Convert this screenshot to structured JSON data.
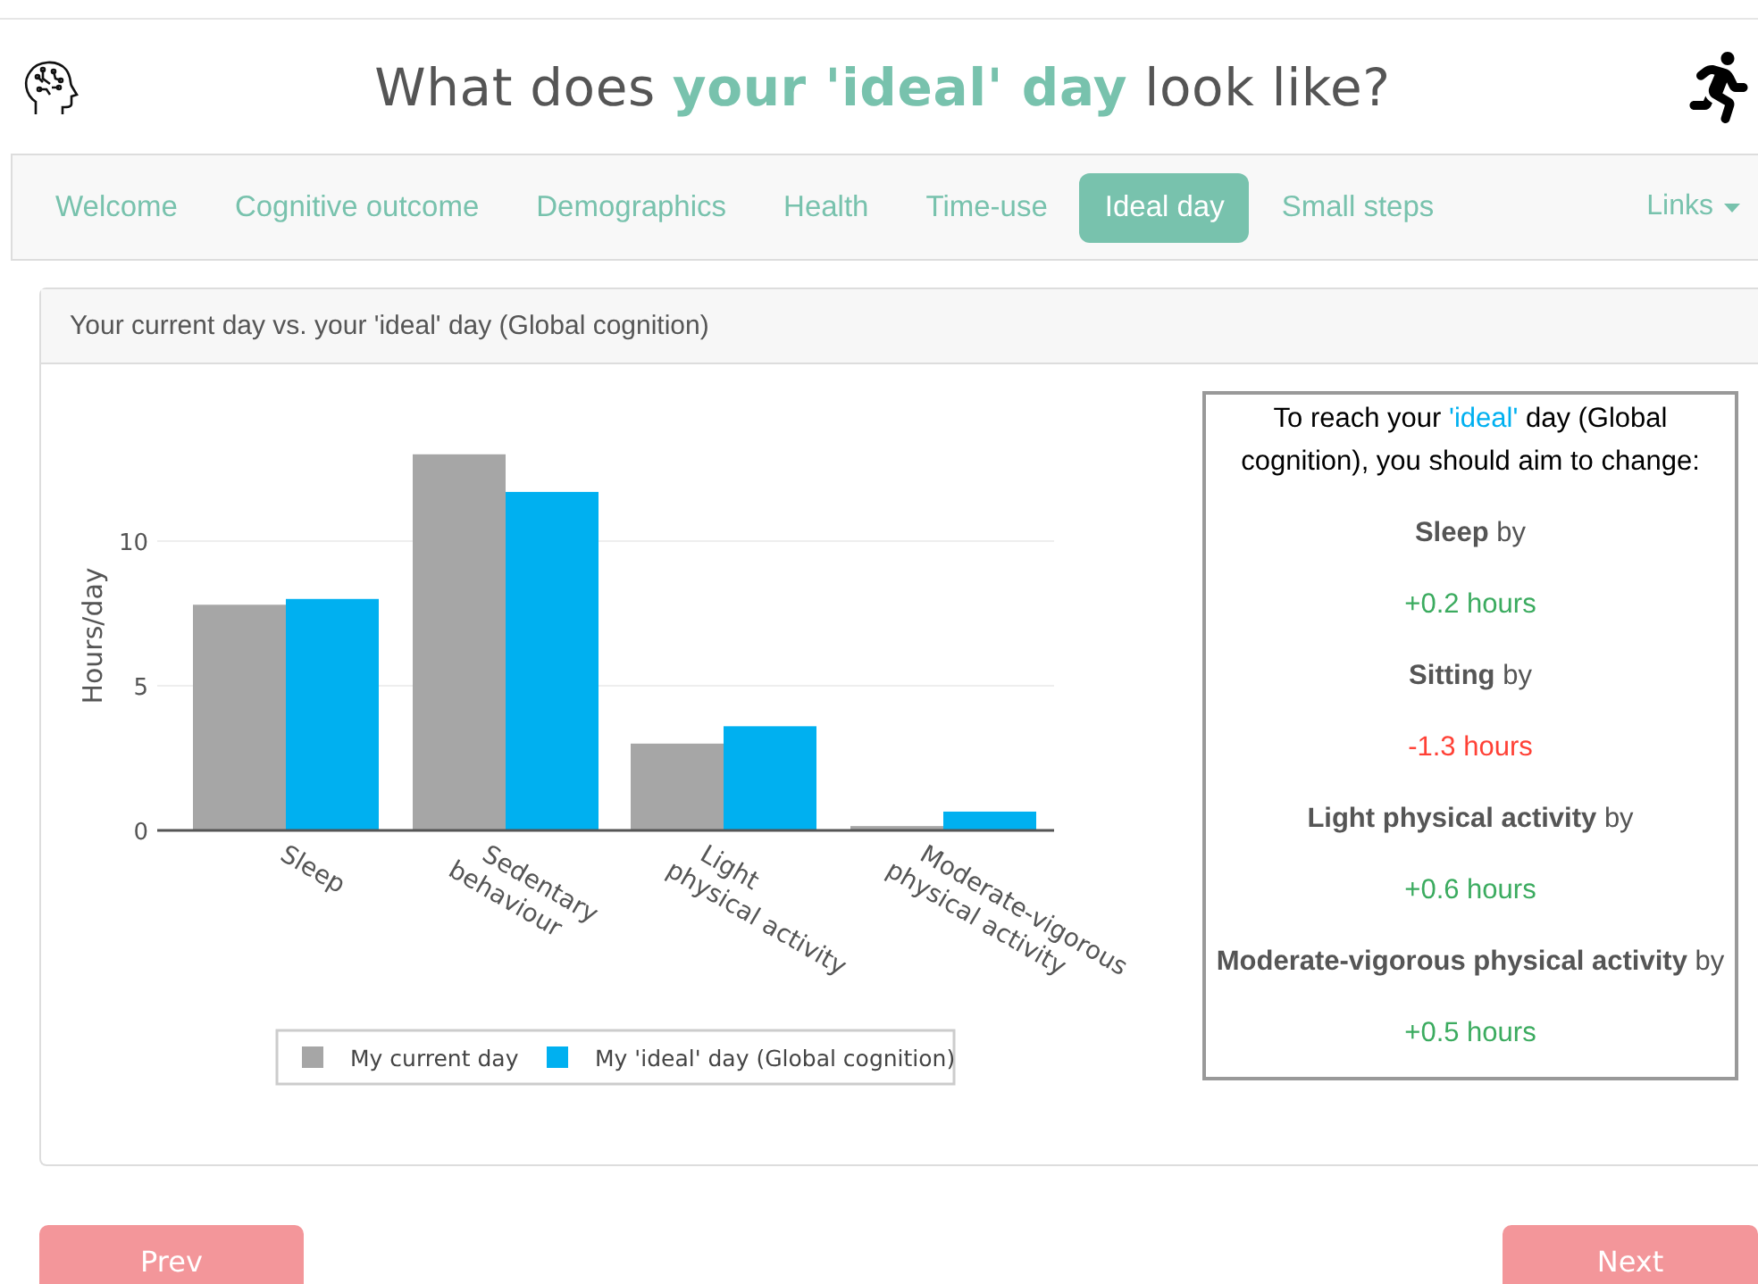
{
  "header": {
    "title": "What does **your 'ideal' day** look like?"
  },
  "nav": {
    "tabs": [
      {
        "label": "Welcome",
        "selected": false
      },
      {
        "label": "Cognitive outcome",
        "selected": false
      },
      {
        "label": "Demographics",
        "selected": false
      },
      {
        "label": "Health",
        "selected": false
      },
      {
        "label": "Time-use",
        "selected": false
      },
      {
        "label": "Ideal day",
        "selected": true
      },
      {
        "label": "Small steps",
        "selected": false
      }
    ],
    "menu": {
      "label": "Links"
    }
  },
  "card": {
    "title": "Your current day vs. your 'ideal' day (Global cognition)",
    "chart_data": {
      "type": "bar",
      "ylabel": "Hours/day",
      "categories": [
        "Sleep",
        "Sedentary behaviour",
        "Light physical activity",
        "Moderate-vigorous physical activity"
      ],
      "series": [
        {
          "name": "My current day",
          "color": "#a6a6a6",
          "values": [
            7.8,
            13.0,
            3.0,
            0.15
          ]
        },
        {
          "name": "My 'ideal' day (Global cognition)",
          "color": "#00b0f0",
          "values": [
            8.0,
            11.7,
            3.6,
            0.65
          ]
        }
      ],
      "yticks": [
        0,
        5,
        10
      ],
      "ylim": [
        0,
        13
      ],
      "legend": "bottom"
    },
    "advice": {
      "intro_before": "To reach your ",
      "intro_highlight": "'ideal'",
      "intro_after": " day (Global cognition), you should aim to change:",
      "changes": [
        {
          "activity": "Sleep",
          "suffix": "by",
          "amount": "+0.2 hours",
          "kind": "increase"
        },
        {
          "activity": "Sitting",
          "suffix": "by",
          "amount": "-1.3 hours",
          "kind": "decrease"
        },
        {
          "activity": "Light physical activity",
          "suffix": "by",
          "amount": "+0.6 hours",
          "kind": "increase"
        },
        {
          "activity": "Moderate-vigorous physical activity",
          "suffix": "by",
          "amount": "+0.5 hours",
          "kind": "increase"
        }
      ]
    }
  },
  "buttons": {
    "prev": "Prev",
    "next": "Next"
  }
}
